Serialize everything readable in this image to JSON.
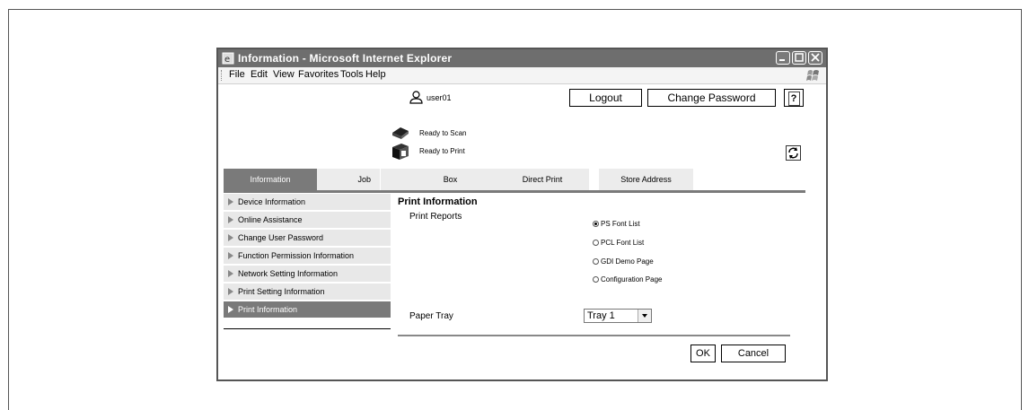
{
  "window": {
    "title": "Information - Microsoft Internet Explorer"
  },
  "menu": {
    "items": [
      "File",
      "Edit",
      "View",
      "Favorites",
      "Tools",
      "Help"
    ]
  },
  "header": {
    "username": "user01",
    "logout_label": "Logout",
    "change_password_label": "Change Password",
    "help_label": "?"
  },
  "status": {
    "scan": "Ready to Scan",
    "print": "Ready to Print"
  },
  "tabs": [
    {
      "label": "Information",
      "active": true
    },
    {
      "label": "Job"
    },
    {
      "label": "Box"
    },
    {
      "label": "Direct Print"
    },
    {
      "label": "Store Address"
    }
  ],
  "sidebar": {
    "items": [
      {
        "label": "Device Information"
      },
      {
        "label": "Online Assistance"
      },
      {
        "label": "Change User Password"
      },
      {
        "label": "Function Permission Information"
      },
      {
        "label": "Network Setting Information"
      },
      {
        "label": "Print Setting Information"
      },
      {
        "label": "Print Information",
        "active": true
      }
    ]
  },
  "main": {
    "title": "Print Information",
    "print_reports_label": "Print Reports",
    "report_options": [
      {
        "label": "PS Font List",
        "selected": true
      },
      {
        "label": "PCL Font List"
      },
      {
        "label": "GDI Demo Page"
      },
      {
        "label": "Configuration Page"
      }
    ],
    "paper_tray_label": "Paper Tray",
    "paper_tray_value": "Tray 1",
    "ok_label": "OK",
    "cancel_label": "Cancel"
  },
  "colors": {
    "titlebar": "#6e6e6e",
    "active_tab": "#7a7a7a",
    "sidebar_bg": "#e8e8e8"
  }
}
